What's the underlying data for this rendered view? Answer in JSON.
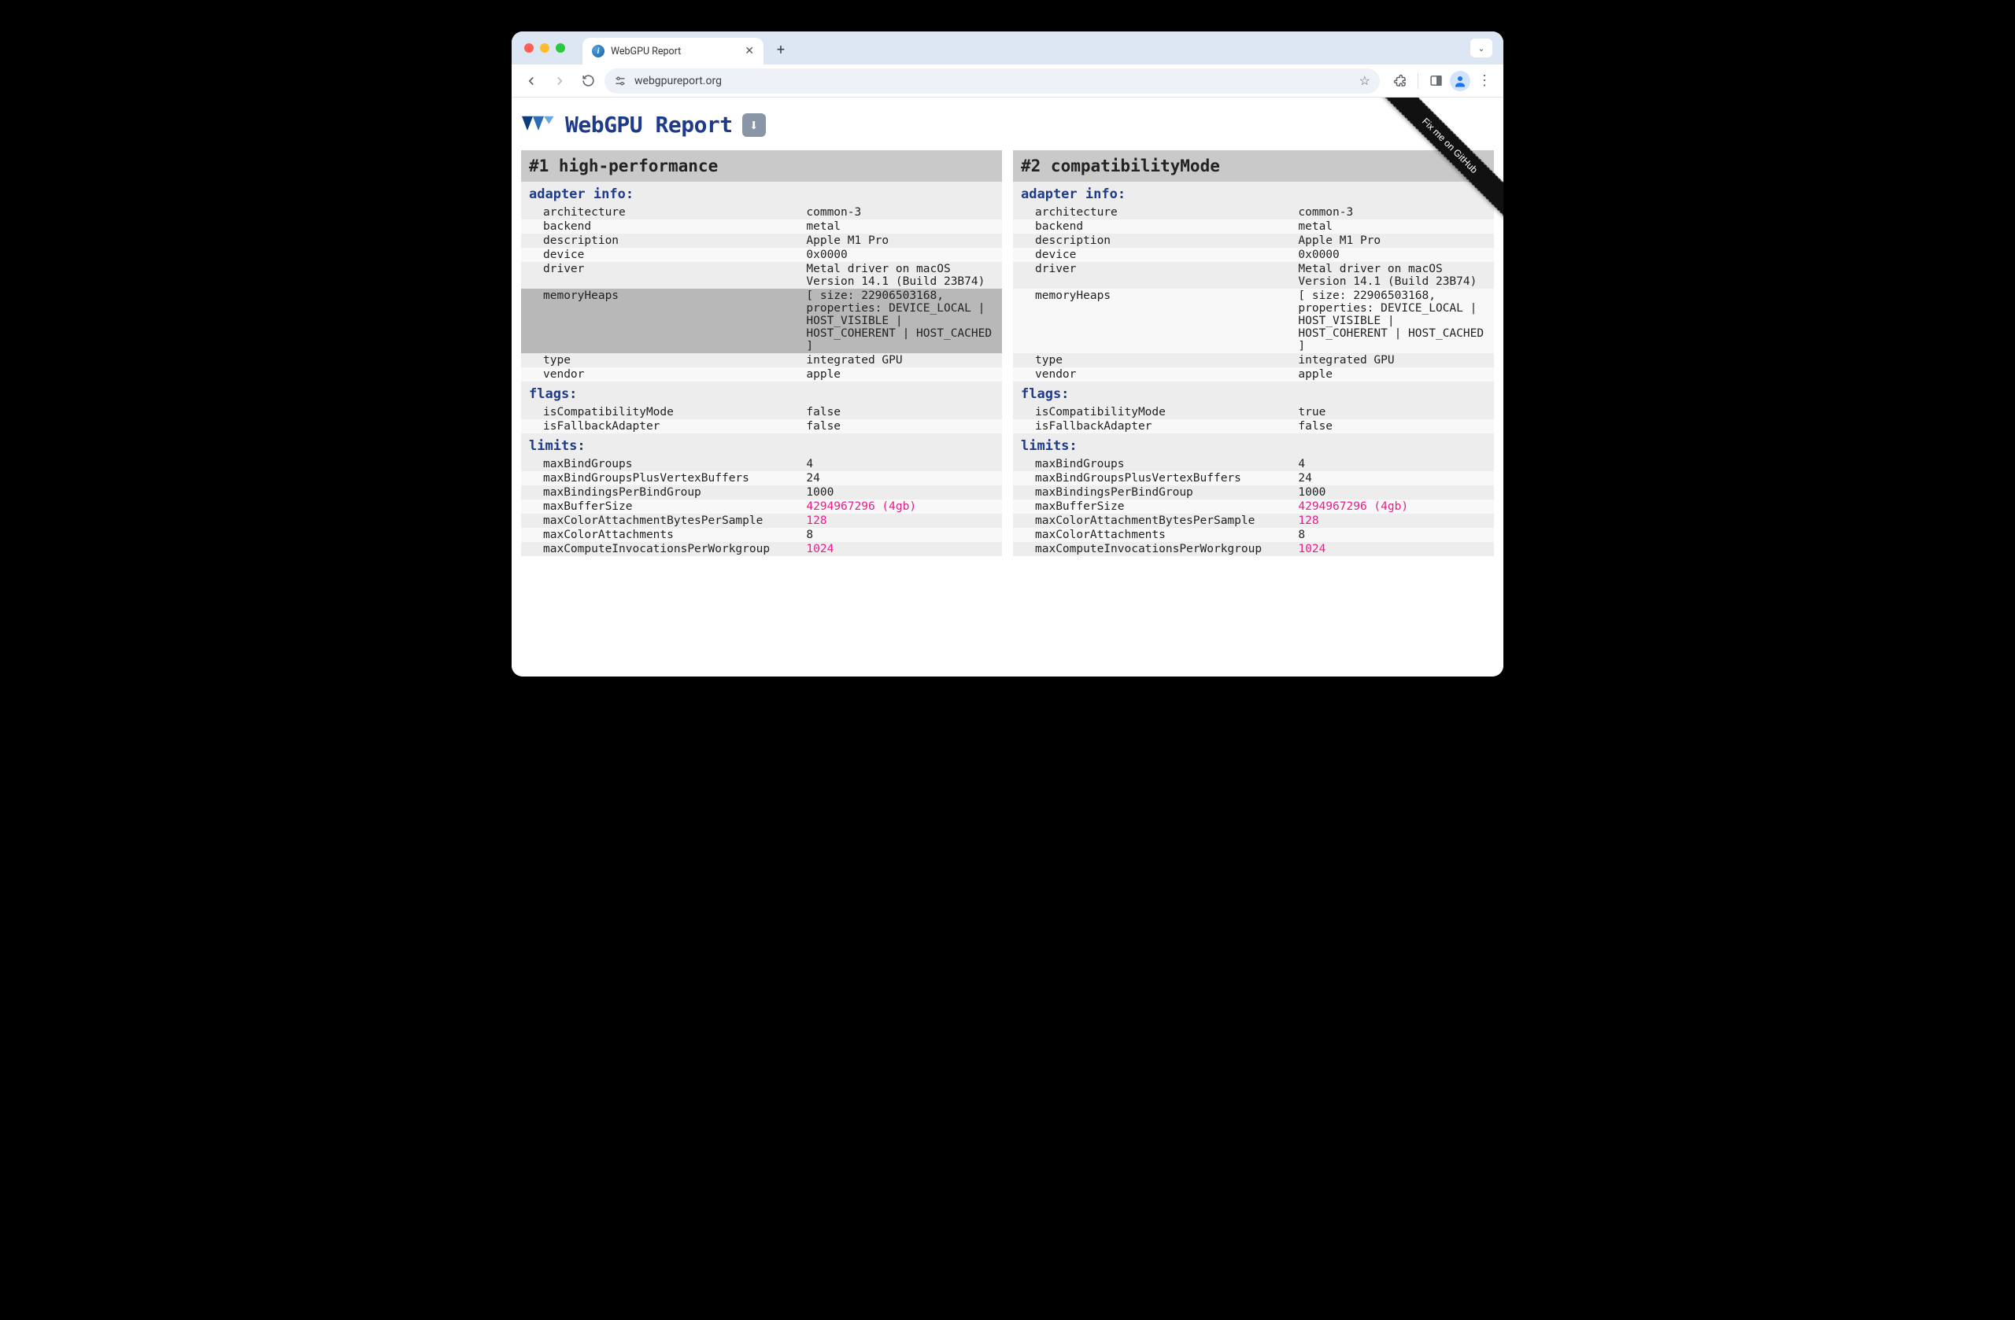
{
  "browser": {
    "tab_title": "WebGPU Report",
    "url": "webgpureport.org"
  },
  "page": {
    "title": "WebGPU Report",
    "ribbon": "Fix me on GitHub"
  },
  "panels": [
    {
      "header": "#1 high-performance",
      "sections": {
        "adapter_info": {
          "label": "adapter info:",
          "rows": [
            {
              "k": "architecture",
              "v": "common-3",
              "hl": false
            },
            {
              "k": "backend",
              "v": "metal",
              "hl": false
            },
            {
              "k": "description",
              "v": "Apple M1 Pro",
              "hl": false
            },
            {
              "k": "device",
              "v": "0x0000",
              "hl": false
            },
            {
              "k": "driver",
              "v": "Metal driver on macOS Version 14.1 (Build 23B74)",
              "hl": false
            },
            {
              "k": "memoryHeaps",
              "v": "[ size: 22906503168, properties: DEVICE_LOCAL | HOST_VISIBLE | HOST_COHERENT | HOST_CACHED ]",
              "hl": true
            },
            {
              "k": "type",
              "v": "integrated GPU",
              "hl": false
            },
            {
              "k": "vendor",
              "v": "apple",
              "hl": false
            }
          ]
        },
        "flags": {
          "label": "flags:",
          "rows": [
            {
              "k": "isCompatibilityMode",
              "v": "false"
            },
            {
              "k": "isFallbackAdapter",
              "v": "false"
            }
          ]
        },
        "limits": {
          "label": "limits:",
          "rows": [
            {
              "k": "maxBindGroups",
              "v": "4"
            },
            {
              "k": "maxBindGroupsPlusVertexBuffers",
              "v": "24"
            },
            {
              "k": "maxBindingsPerBindGroup",
              "v": "1000"
            },
            {
              "k": "maxBufferSize",
              "v": "4294967296 (4gb)",
              "pink": true
            },
            {
              "k": "maxColorAttachmentBytesPerSample",
              "v": "128",
              "pink": true
            },
            {
              "k": "maxColorAttachments",
              "v": "8"
            },
            {
              "k": "maxComputeInvocationsPerWorkgroup",
              "v": "1024",
              "pink": true
            }
          ]
        }
      }
    },
    {
      "header": "#2 compatibilityMode",
      "sections": {
        "adapter_info": {
          "label": "adapter info:",
          "rows": [
            {
              "k": "architecture",
              "v": "common-3",
              "hl": false
            },
            {
              "k": "backend",
              "v": "metal",
              "hl": false
            },
            {
              "k": "description",
              "v": "Apple M1 Pro",
              "hl": false
            },
            {
              "k": "device",
              "v": "0x0000",
              "hl": false
            },
            {
              "k": "driver",
              "v": "Metal driver on macOS Version 14.1 (Build 23B74)",
              "hl": false
            },
            {
              "k": "memoryHeaps",
              "v": "[ size: 22906503168, properties: DEVICE_LOCAL | HOST_VISIBLE | HOST_COHERENT | HOST_CACHED ]",
              "hl": false
            },
            {
              "k": "type",
              "v": "integrated GPU",
              "hl": false
            },
            {
              "k": "vendor",
              "v": "apple",
              "hl": false
            }
          ]
        },
        "flags": {
          "label": "flags:",
          "rows": [
            {
              "k": "isCompatibilityMode",
              "v": "true"
            },
            {
              "k": "isFallbackAdapter",
              "v": "false"
            }
          ]
        },
        "limits": {
          "label": "limits:",
          "rows": [
            {
              "k": "maxBindGroups",
              "v": "4"
            },
            {
              "k": "maxBindGroupsPlusVertexBuffers",
              "v": "24"
            },
            {
              "k": "maxBindingsPerBindGroup",
              "v": "1000"
            },
            {
              "k": "maxBufferSize",
              "v": "4294967296 (4gb)",
              "pink": true
            },
            {
              "k": "maxColorAttachmentBytesPerSample",
              "v": "128",
              "pink": true
            },
            {
              "k": "maxColorAttachments",
              "v": "8"
            },
            {
              "k": "maxComputeInvocationsPerWorkgroup",
              "v": "1024",
              "pink": true
            }
          ]
        }
      }
    }
  ]
}
